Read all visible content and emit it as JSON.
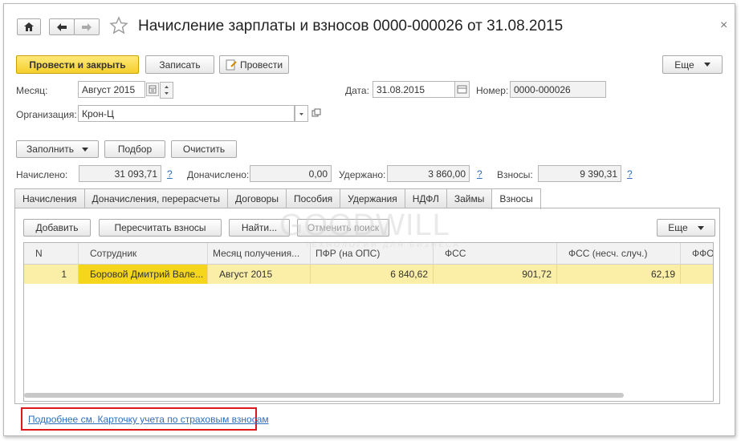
{
  "window": {
    "title": "Начисление зарплаты и взносов 0000-000026 от 31.08.2015",
    "close_glyph": "×"
  },
  "toolbar": {
    "post_close": "Провести и закрыть",
    "save": "Записать",
    "post": "Провести",
    "more": "Еще"
  },
  "form": {
    "month_label": "Месяц:",
    "month_value": "Август 2015",
    "date_label": "Дата:",
    "date_value": "31.08.2015",
    "number_label": "Номер:",
    "number_value": "0000-000026",
    "org_label": "Организация:",
    "org_value": "Крон-Ц"
  },
  "actions": {
    "fill": "Заполнить",
    "pick": "Подбор",
    "clear": "Очистить"
  },
  "totals": {
    "accrued_label": "Начислено:",
    "accrued_value": "31 093,71",
    "extra_label": "Доначислено:",
    "extra_value": "0,00",
    "withheld_label": "Удержано:",
    "withheld_value": "3 860,00",
    "contrib_label": "Взносы:",
    "contrib_value": "9 390,31",
    "help": "?"
  },
  "tabs": [
    "Начисления",
    "Доначисления, перерасчеты",
    "Договоры",
    "Пособия",
    "Удержания",
    "НДФЛ",
    "Займы",
    "Взносы"
  ],
  "panel": {
    "add": "Добавить",
    "recalc": "Пересчитать взносы",
    "find": "Найти...",
    "cancel_search": "Отменить поиск",
    "more": "Еще"
  },
  "table": {
    "columns": [
      "N",
      "Сотрудник",
      "Месяц получения...",
      "ПФР (на ОПС)",
      "ФСС",
      "ФСС (несч. случ.)",
      "ФФО"
    ],
    "rows": [
      [
        "1",
        "Боровой Дмитрий Вале...",
        "Август 2015",
        "6 840,62",
        "901,72",
        "62,19",
        ""
      ]
    ]
  },
  "footer_link": "Подробнее см. Карточку учета по страховым взносам",
  "watermark": {
    "brand": "GOODWILL",
    "tagline": "ТЕХНОЛОГИИ ДЛЯ БИЗНЕСА"
  },
  "colors": {
    "accent_button": "#f5cf2c",
    "selected_row": "#fbeea6",
    "link": "#2f6fbf",
    "highlight_box": "#e0181b"
  }
}
